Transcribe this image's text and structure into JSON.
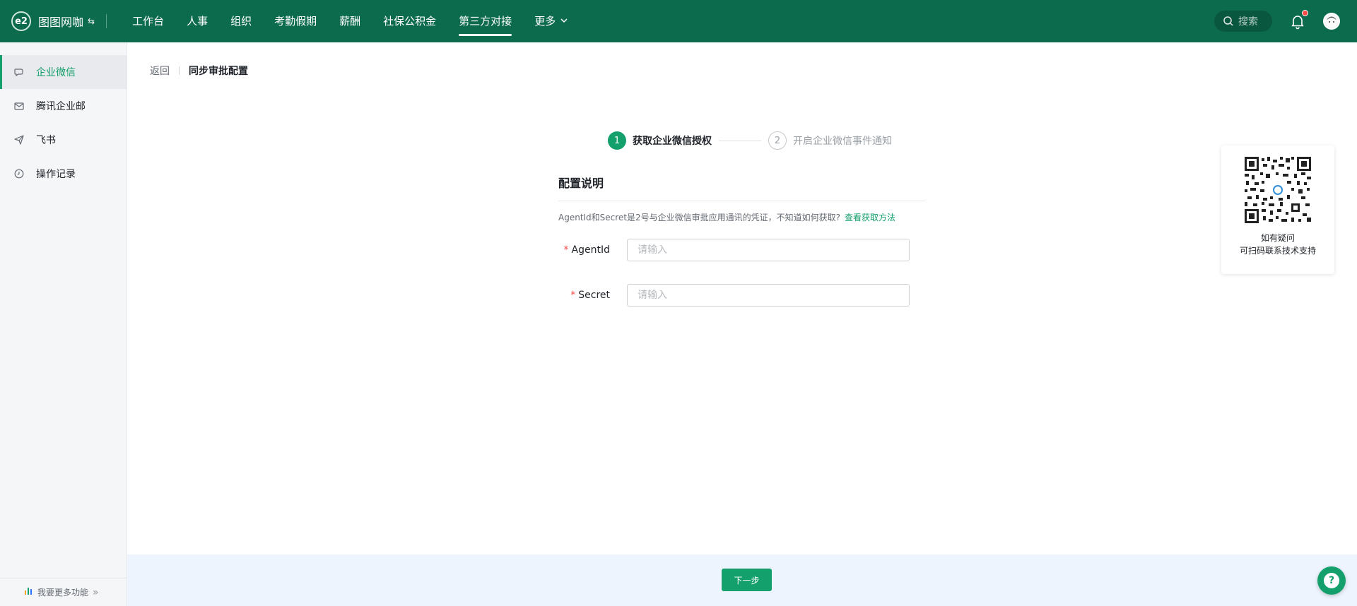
{
  "brand": {
    "logo_text": "e2",
    "name": "图图网咖"
  },
  "nav": {
    "items": [
      {
        "label": "工作台"
      },
      {
        "label": "人事"
      },
      {
        "label": "组织"
      },
      {
        "label": "考勤假期"
      },
      {
        "label": "薪酬"
      },
      {
        "label": "社保公积金"
      },
      {
        "label": "第三方对接",
        "active": true
      },
      {
        "label": "更多"
      }
    ]
  },
  "search": {
    "placeholder": "搜索"
  },
  "sidebar": {
    "items": [
      {
        "label": "企业微信",
        "icon": "chat-icon",
        "active": true
      },
      {
        "label": "腾讯企业邮",
        "icon": "mail-icon"
      },
      {
        "label": "飞书",
        "icon": "paper-plane-icon"
      },
      {
        "label": "操作记录",
        "icon": "clock-icon"
      }
    ],
    "footer_label": "我要更多功能"
  },
  "breadcrumb": {
    "back": "返回",
    "current": "同步审批配置"
  },
  "steps": [
    {
      "number": "1",
      "label": "获取企业微信授权",
      "status": "active"
    },
    {
      "number": "2",
      "label": "开启企业微信事件通知",
      "status": "pending"
    }
  ],
  "config": {
    "title": "配置说明",
    "description": "AgentId和Secret是2号与企业微信审批应用通讯的凭证，不知道如何获取?",
    "link": "查看获取方法",
    "fields": [
      {
        "label": "AgentId",
        "required": true,
        "value": "",
        "placeholder": "请输入"
      },
      {
        "label": "Secret",
        "required": true,
        "value": "",
        "placeholder": "请输入"
      }
    ]
  },
  "qr_card": {
    "line1": "如有疑问",
    "line2": "可扫码联系技术支持"
  },
  "footer": {
    "next_button": "下一步"
  },
  "colors": {
    "header": "#0c6b4d",
    "accent": "#14a06c",
    "notification": "#f54a45"
  }
}
